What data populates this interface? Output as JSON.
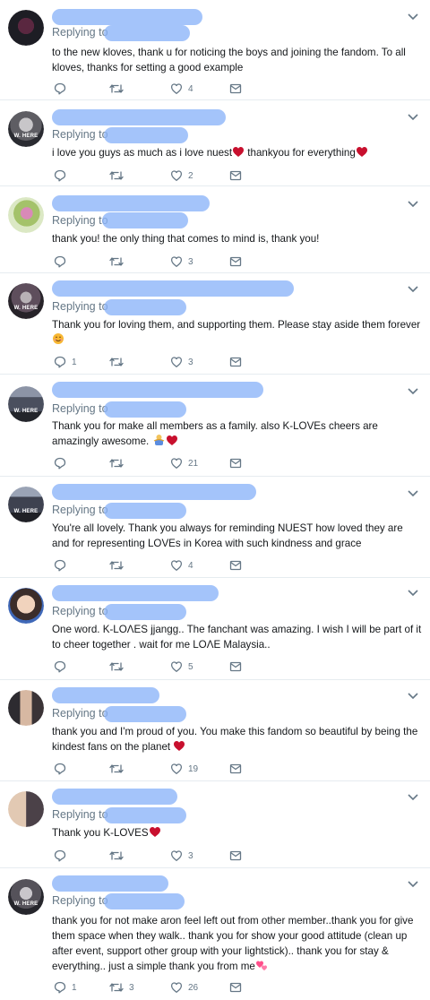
{
  "reply_prefix": "Replying to",
  "accent": "#8ab4f8",
  "icons": [
    "reply-icon",
    "retweet-icon",
    "like-icon",
    "dm-icon",
    "chevron-down-icon"
  ],
  "tweets": [
    {
      "text": "to the new kloves, thank u for noticing the boys and joining the fandom. To all kloves, thanks for setting a good example",
      "replies": "",
      "retweets": "",
      "likes": "4",
      "avatar_label": ""
    },
    {
      "text": "i love you guys as much as i love nuest",
      "text2": " thankyou for everything",
      "replies": "",
      "retweets": "",
      "likes": "2",
      "avatar_label": "W. HERE"
    },
    {
      "text": "thank you! the only thing that comes to mind is, thank you!",
      "replies": "",
      "retweets": "",
      "likes": "3",
      "avatar_label": ""
    },
    {
      "text": "Thank you for loving them,  and supporting them.  Please stay aside them forever",
      "replies": "1",
      "retweets": "",
      "likes": "3",
      "avatar_label": "W. HERE"
    },
    {
      "text": "Thank you for make all members as a family. also K-LOVEs cheers are amazingly awesome.",
      "replies": "",
      "retweets": "",
      "likes": "21",
      "avatar_label": "W. HERE"
    },
    {
      "text": "You're all lovely. Thank you always for reminding NUEST how loved they are and for representing LOVEs in Korea with such kindness and grace",
      "replies": "",
      "retweets": "",
      "likes": "4",
      "avatar_label": "W. HERE"
    },
    {
      "text": "One word. K-LOΛES jjangg.. The fanchant was amazing. I wish I will be part of it to cheer together . wait for me LOΛE Malaysia..",
      "replies": "",
      "retweets": "",
      "likes": "5",
      "avatar_label": ""
    },
    {
      "text": "thank you and I'm proud of you. You make this fandom so beautiful by being the kindest fans on the planet",
      "replies": "",
      "retweets": "",
      "likes": "19",
      "avatar_label": ""
    },
    {
      "text": "Thank you K-LOVES",
      "replies": "",
      "retweets": "",
      "likes": "3",
      "avatar_label": ""
    },
    {
      "text": "thank you for not make aron feel left out from other member..thank you for give them space when they walk.. thank you for show your good attitude (clean up after event, support other group with your lightstick).. thank you for stay & everything.. just a simple thank you from me",
      "replies": "1",
      "retweets": "3",
      "likes": "26",
      "avatar_label": "W. HERE"
    }
  ]
}
